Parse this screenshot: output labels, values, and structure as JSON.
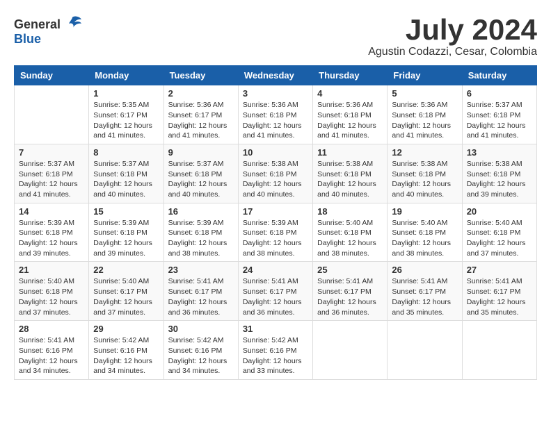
{
  "header": {
    "logo_general": "General",
    "logo_blue": "Blue",
    "month_year": "July 2024",
    "location": "Agustin Codazzi, Cesar, Colombia"
  },
  "weekdays": [
    "Sunday",
    "Monday",
    "Tuesday",
    "Wednesday",
    "Thursday",
    "Friday",
    "Saturday"
  ],
  "weeks": [
    [
      {
        "day": "",
        "sunrise": "",
        "sunset": "",
        "daylight": ""
      },
      {
        "day": "1",
        "sunrise": "Sunrise: 5:35 AM",
        "sunset": "Sunset: 6:17 PM",
        "daylight": "Daylight: 12 hours and 41 minutes."
      },
      {
        "day": "2",
        "sunrise": "Sunrise: 5:36 AM",
        "sunset": "Sunset: 6:17 PM",
        "daylight": "Daylight: 12 hours and 41 minutes."
      },
      {
        "day": "3",
        "sunrise": "Sunrise: 5:36 AM",
        "sunset": "Sunset: 6:18 PM",
        "daylight": "Daylight: 12 hours and 41 minutes."
      },
      {
        "day": "4",
        "sunrise": "Sunrise: 5:36 AM",
        "sunset": "Sunset: 6:18 PM",
        "daylight": "Daylight: 12 hours and 41 minutes."
      },
      {
        "day": "5",
        "sunrise": "Sunrise: 5:36 AM",
        "sunset": "Sunset: 6:18 PM",
        "daylight": "Daylight: 12 hours and 41 minutes."
      },
      {
        "day": "6",
        "sunrise": "Sunrise: 5:37 AM",
        "sunset": "Sunset: 6:18 PM",
        "daylight": "Daylight: 12 hours and 41 minutes."
      }
    ],
    [
      {
        "day": "7",
        "sunrise": "Sunrise: 5:37 AM",
        "sunset": "Sunset: 6:18 PM",
        "daylight": "Daylight: 12 hours and 41 minutes."
      },
      {
        "day": "8",
        "sunrise": "Sunrise: 5:37 AM",
        "sunset": "Sunset: 6:18 PM",
        "daylight": "Daylight: 12 hours and 40 minutes."
      },
      {
        "day": "9",
        "sunrise": "Sunrise: 5:37 AM",
        "sunset": "Sunset: 6:18 PM",
        "daylight": "Daylight: 12 hours and 40 minutes."
      },
      {
        "day": "10",
        "sunrise": "Sunrise: 5:38 AM",
        "sunset": "Sunset: 6:18 PM",
        "daylight": "Daylight: 12 hours and 40 minutes."
      },
      {
        "day": "11",
        "sunrise": "Sunrise: 5:38 AM",
        "sunset": "Sunset: 6:18 PM",
        "daylight": "Daylight: 12 hours and 40 minutes."
      },
      {
        "day": "12",
        "sunrise": "Sunrise: 5:38 AM",
        "sunset": "Sunset: 6:18 PM",
        "daylight": "Daylight: 12 hours and 40 minutes."
      },
      {
        "day": "13",
        "sunrise": "Sunrise: 5:38 AM",
        "sunset": "Sunset: 6:18 PM",
        "daylight": "Daylight: 12 hours and 39 minutes."
      }
    ],
    [
      {
        "day": "14",
        "sunrise": "Sunrise: 5:39 AM",
        "sunset": "Sunset: 6:18 PM",
        "daylight": "Daylight: 12 hours and 39 minutes."
      },
      {
        "day": "15",
        "sunrise": "Sunrise: 5:39 AM",
        "sunset": "Sunset: 6:18 PM",
        "daylight": "Daylight: 12 hours and 39 minutes."
      },
      {
        "day": "16",
        "sunrise": "Sunrise: 5:39 AM",
        "sunset": "Sunset: 6:18 PM",
        "daylight": "Daylight: 12 hours and 38 minutes."
      },
      {
        "day": "17",
        "sunrise": "Sunrise: 5:39 AM",
        "sunset": "Sunset: 6:18 PM",
        "daylight": "Daylight: 12 hours and 38 minutes."
      },
      {
        "day": "18",
        "sunrise": "Sunrise: 5:40 AM",
        "sunset": "Sunset: 6:18 PM",
        "daylight": "Daylight: 12 hours and 38 minutes."
      },
      {
        "day": "19",
        "sunrise": "Sunrise: 5:40 AM",
        "sunset": "Sunset: 6:18 PM",
        "daylight": "Daylight: 12 hours and 38 minutes."
      },
      {
        "day": "20",
        "sunrise": "Sunrise: 5:40 AM",
        "sunset": "Sunset: 6:18 PM",
        "daylight": "Daylight: 12 hours and 37 minutes."
      }
    ],
    [
      {
        "day": "21",
        "sunrise": "Sunrise: 5:40 AM",
        "sunset": "Sunset: 6:18 PM",
        "daylight": "Daylight: 12 hours and 37 minutes."
      },
      {
        "day": "22",
        "sunrise": "Sunrise: 5:40 AM",
        "sunset": "Sunset: 6:17 PM",
        "daylight": "Daylight: 12 hours and 37 minutes."
      },
      {
        "day": "23",
        "sunrise": "Sunrise: 5:41 AM",
        "sunset": "Sunset: 6:17 PM",
        "daylight": "Daylight: 12 hours and 36 minutes."
      },
      {
        "day": "24",
        "sunrise": "Sunrise: 5:41 AM",
        "sunset": "Sunset: 6:17 PM",
        "daylight": "Daylight: 12 hours and 36 minutes."
      },
      {
        "day": "25",
        "sunrise": "Sunrise: 5:41 AM",
        "sunset": "Sunset: 6:17 PM",
        "daylight": "Daylight: 12 hours and 36 minutes."
      },
      {
        "day": "26",
        "sunrise": "Sunrise: 5:41 AM",
        "sunset": "Sunset: 6:17 PM",
        "daylight": "Daylight: 12 hours and 35 minutes."
      },
      {
        "day": "27",
        "sunrise": "Sunrise: 5:41 AM",
        "sunset": "Sunset: 6:17 PM",
        "daylight": "Daylight: 12 hours and 35 minutes."
      }
    ],
    [
      {
        "day": "28",
        "sunrise": "Sunrise: 5:41 AM",
        "sunset": "Sunset: 6:16 PM",
        "daylight": "Daylight: 12 hours and 34 minutes."
      },
      {
        "day": "29",
        "sunrise": "Sunrise: 5:42 AM",
        "sunset": "Sunset: 6:16 PM",
        "daylight": "Daylight: 12 hours and 34 minutes."
      },
      {
        "day": "30",
        "sunrise": "Sunrise: 5:42 AM",
        "sunset": "Sunset: 6:16 PM",
        "daylight": "Daylight: 12 hours and 34 minutes."
      },
      {
        "day": "31",
        "sunrise": "Sunrise: 5:42 AM",
        "sunset": "Sunset: 6:16 PM",
        "daylight": "Daylight: 12 hours and 33 minutes."
      },
      {
        "day": "",
        "sunrise": "",
        "sunset": "",
        "daylight": ""
      },
      {
        "day": "",
        "sunrise": "",
        "sunset": "",
        "daylight": ""
      },
      {
        "day": "",
        "sunrise": "",
        "sunset": "",
        "daylight": ""
      }
    ]
  ]
}
